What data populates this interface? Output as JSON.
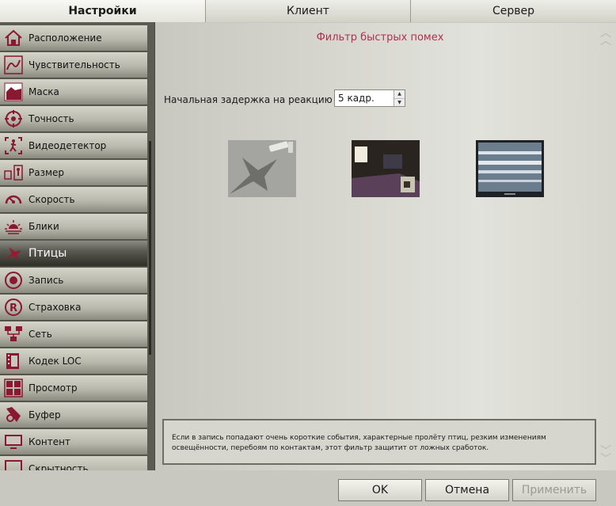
{
  "tabs": [
    {
      "label": "Настройки",
      "active": true
    },
    {
      "label": "Клиент",
      "active": false
    },
    {
      "label": "Сервер",
      "active": false
    }
  ],
  "sidebar": {
    "items": [
      {
        "label": "Расположение",
        "icon": "house-icon"
      },
      {
        "label": "Чувствительность",
        "icon": "sensitivity-icon"
      },
      {
        "label": "Маска",
        "icon": "mask-icon"
      },
      {
        "label": "Точность",
        "icon": "crosshair-icon"
      },
      {
        "label": "Видеодетектор",
        "icon": "motion-detector-icon"
      },
      {
        "label": "Размер",
        "icon": "size-icon"
      },
      {
        "label": "Скорость",
        "icon": "speedometer-icon"
      },
      {
        "label": "Блики",
        "icon": "sunrise-icon"
      },
      {
        "label": "Птицы",
        "icon": "bird-icon",
        "active": true
      },
      {
        "label": "Запись",
        "icon": "record-icon"
      },
      {
        "label": "Страховка",
        "icon": "registered-icon"
      },
      {
        "label": "Сеть",
        "icon": "network-icon"
      },
      {
        "label": "Кодек LOC",
        "icon": "film-icon"
      },
      {
        "label": "Просмотр",
        "icon": "view-grid-icon"
      },
      {
        "label": "Буфер",
        "icon": "buffer-icon"
      },
      {
        "label": "Контент",
        "icon": "monitor-icon"
      },
      {
        "label": "Скрытность",
        "icon": "hidden-icon"
      }
    ]
  },
  "panel": {
    "title": "Фильтр быстрых помех",
    "delay_label": "Начальная задержка на реакцию",
    "delay_value": "5 кадр.",
    "info_text": "Если в запись попадают очень короткие события, характерные пролёту птиц, резким изменениям освещённости, перебоям по контактам, этот фильтр защитит от ложных сработок."
  },
  "buttons": {
    "ok": "OK",
    "cancel": "Отмена",
    "apply": "Применить"
  },
  "colors": {
    "accent": "#b0304c",
    "title": "#b0304c"
  }
}
